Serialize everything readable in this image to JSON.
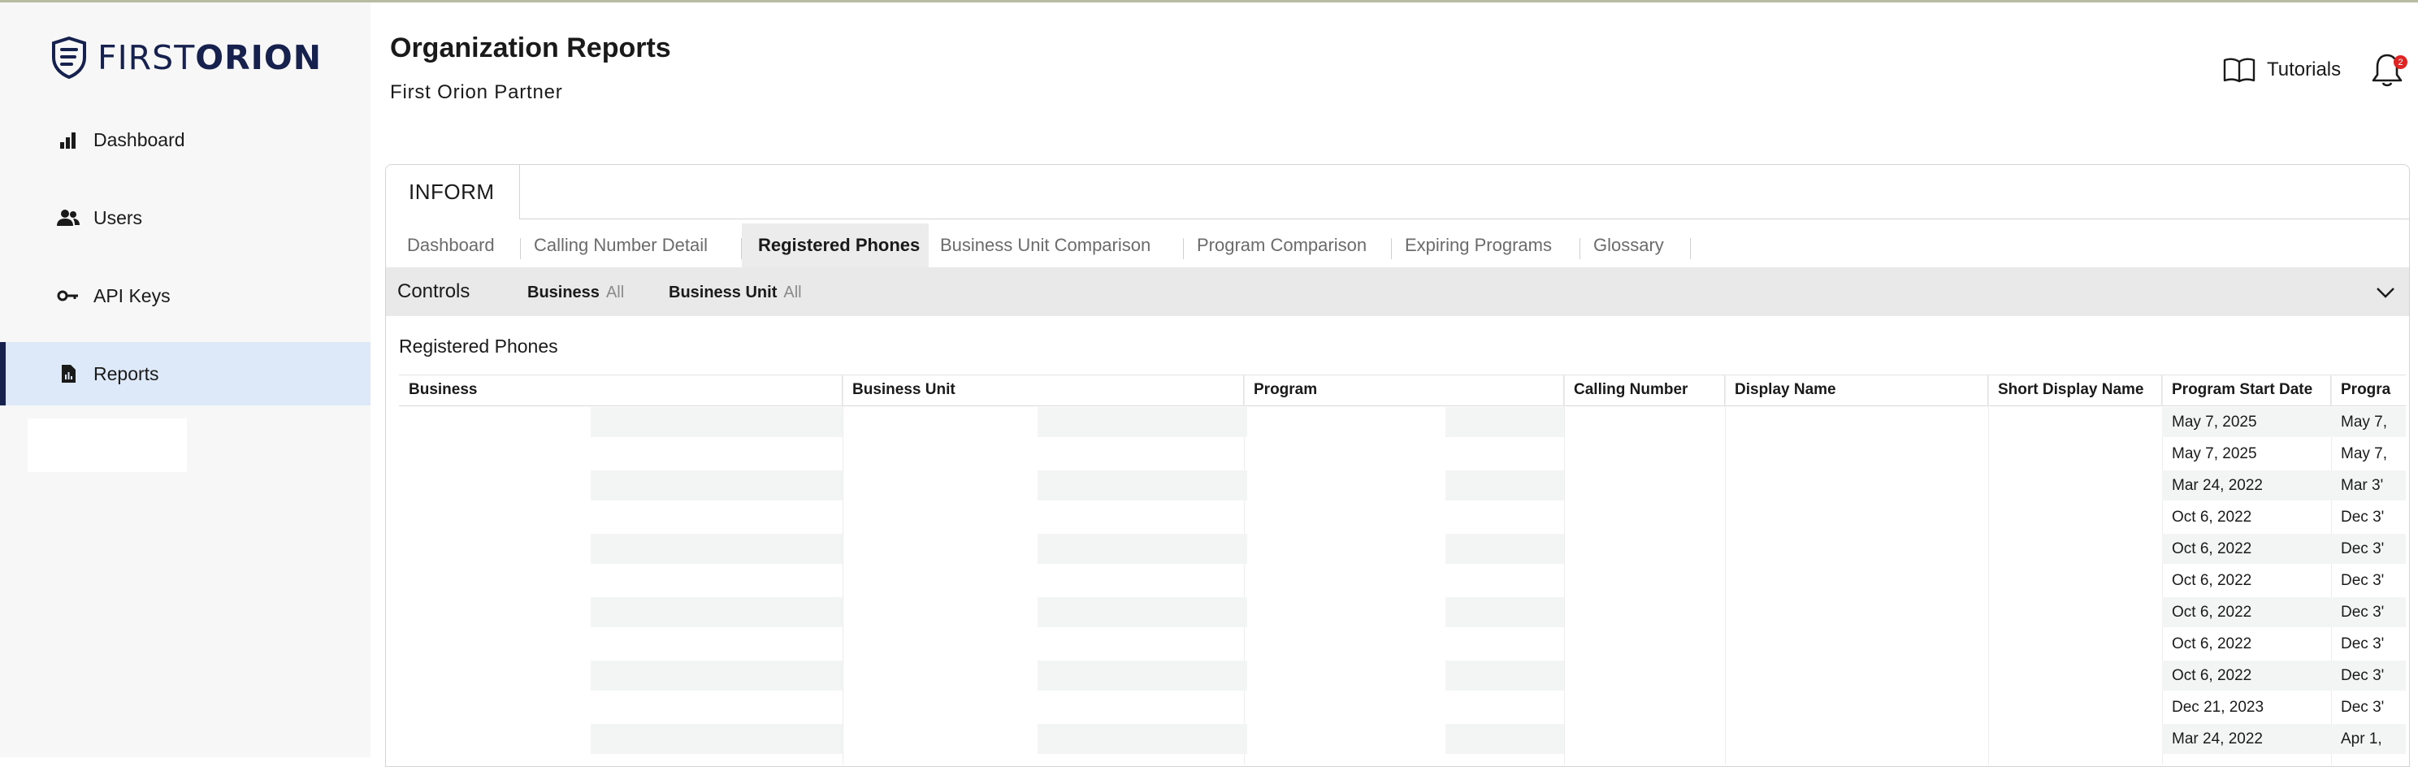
{
  "brand": {
    "word1": "FIRST",
    "word2": "ORION",
    "color": "#16214d"
  },
  "sidebar": {
    "items": [
      {
        "label": "Dashboard",
        "icon": "bar-chart-icon"
      },
      {
        "label": "Users",
        "icon": "users-icon"
      },
      {
        "label": "API Keys",
        "icon": "key-icon"
      },
      {
        "label": "Reports",
        "icon": "report-icon",
        "active": true
      }
    ]
  },
  "header": {
    "title": "Organization Reports",
    "subtitle": "First Orion Partner",
    "tutorials_label": "Tutorials",
    "notification_count": "2"
  },
  "panel": {
    "product_tab": "INFORM",
    "tabs": [
      {
        "label": "Dashboard"
      },
      {
        "label": "Calling Number Detail"
      },
      {
        "label": "Registered Phones",
        "active": true
      },
      {
        "label": "Business Unit Comparison"
      },
      {
        "label": "Program Comparison"
      },
      {
        "label": "Expiring Programs"
      },
      {
        "label": "Glossary"
      }
    ],
    "controls": {
      "label": "Controls",
      "filters": [
        {
          "name": "Business",
          "value": "All"
        },
        {
          "name": "Business Unit",
          "value": "All"
        }
      ]
    },
    "section_title": "Registered Phones"
  },
  "table": {
    "columns": [
      "Business",
      "Business Unit",
      "Program",
      "Calling Number",
      "Display Name",
      "Short Display Name",
      "Program Start Date",
      "Progra"
    ],
    "rows": [
      {
        "start": "May 7, 2025",
        "end": "May 7,"
      },
      {
        "start": "May 7, 2025",
        "end": "May 7,"
      },
      {
        "start": "Mar 24, 2022",
        "end": "Mar 3'"
      },
      {
        "start": "Oct 6, 2022",
        "end": "Dec 3'"
      },
      {
        "start": "Oct 6, 2022",
        "end": "Dec 3'"
      },
      {
        "start": "Oct 6, 2022",
        "end": "Dec 3'"
      },
      {
        "start": "Oct 6, 2022",
        "end": "Dec 3'"
      },
      {
        "start": "Oct 6, 2022",
        "end": "Dec 3'"
      },
      {
        "start": "Oct 6, 2022",
        "end": "Dec 3'"
      },
      {
        "start": "Dec 21, 2023",
        "end": "Dec 3'"
      },
      {
        "start": "Mar 24, 2022",
        "end": "Apr 1,"
      }
    ]
  }
}
